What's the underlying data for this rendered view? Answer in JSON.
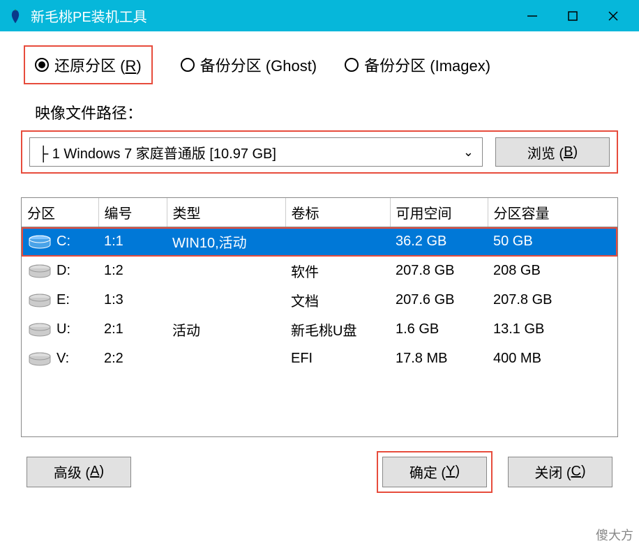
{
  "titlebar": {
    "app_title": "新毛桃PE装机工具"
  },
  "radios": {
    "restore": "还原分区 (R)",
    "backup_ghost": "备份分区 (Ghost)",
    "backup_imagex": "备份分区 (Imagex)"
  },
  "path": {
    "label": "映像文件路径：",
    "selected": "├ 1 Windows 7 家庭普通版 [10.97 GB]",
    "browse": "浏览 (B)"
  },
  "table": {
    "headers": [
      "分区",
      "编号",
      "类型",
      "卷标",
      "可用空间",
      "分区容量"
    ],
    "rows": [
      {
        "drive": "C:",
        "id": "1:1",
        "type": "WIN10,活动",
        "label": "",
        "free": "36.2 GB",
        "total": "50 GB",
        "selected": true
      },
      {
        "drive": "D:",
        "id": "1:2",
        "type": "",
        "label": "软件",
        "free": "207.8 GB",
        "total": "208 GB",
        "selected": false
      },
      {
        "drive": "E:",
        "id": "1:3",
        "type": "",
        "label": "文档",
        "free": "207.6 GB",
        "total": "207.8 GB",
        "selected": false
      },
      {
        "drive": "U:",
        "id": "2:1",
        "type": "活动",
        "label": "新毛桃U盘",
        "free": "1.6 GB",
        "total": "13.1 GB",
        "selected": false
      },
      {
        "drive": "V:",
        "id": "2:2",
        "type": "",
        "label": "EFI",
        "free": "17.8 MB",
        "total": "400 MB",
        "selected": false
      }
    ]
  },
  "buttons": {
    "advanced": "高级 (A)",
    "ok": "确定 (Y)",
    "close": "关闭 (C)"
  },
  "watermark": "傻大方"
}
